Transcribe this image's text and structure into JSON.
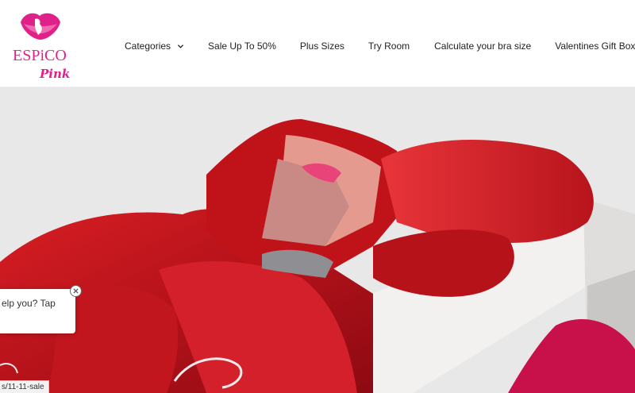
{
  "brand": {
    "logo_text": "ESPiCO",
    "logo_subtext": "Pink",
    "color": "#e0218a"
  },
  "nav": {
    "items": [
      {
        "label": "Categories",
        "has_dropdown": true
      },
      {
        "label": "Sale Up To 50%"
      },
      {
        "label": "Plus Sizes"
      },
      {
        "label": "Try Room"
      },
      {
        "label": "Calculate your bra size"
      },
      {
        "label": "Valentines Gift Box"
      }
    ]
  },
  "hero": {
    "description_colors": {
      "satin": "#c8161d",
      "box": "#f3f1ef",
      "background": "#e8e8e8"
    }
  },
  "chat_widget": {
    "text": "elp you? Tap"
  },
  "status_bar": {
    "url": "s/11-11-sale"
  }
}
